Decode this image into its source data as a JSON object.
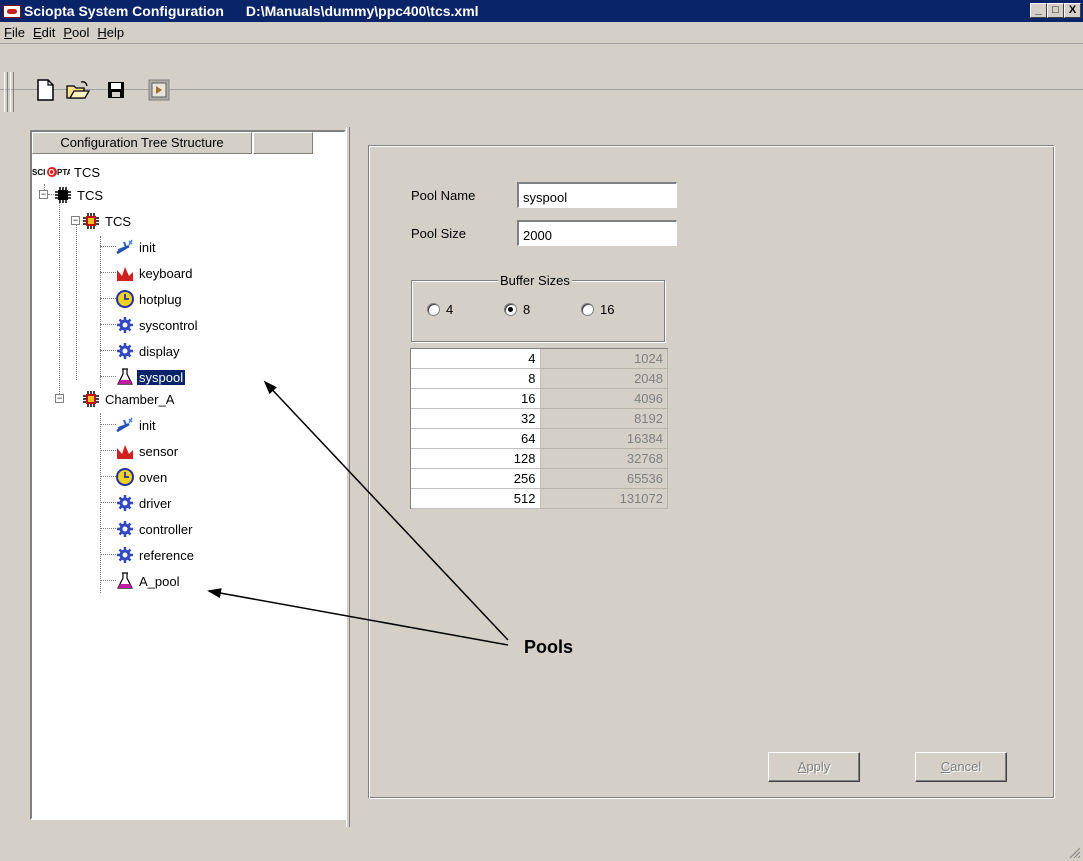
{
  "window": {
    "title": "Sciopta System Configuration",
    "path": "D:\\Manuals\\dummy\\ppc400\\tcs.xml",
    "controls": [
      "_",
      "□",
      "X"
    ]
  },
  "menu": [
    {
      "label": "File",
      "accel": "F",
      "rest": "ile"
    },
    {
      "label": "Edit",
      "accel": "E",
      "rest": "dit"
    },
    {
      "label": "Pool",
      "accel": "P",
      "rest": "ool"
    },
    {
      "label": "Help",
      "accel": "H",
      "rest": "elp"
    }
  ],
  "toolbar": {
    "buttons": [
      "new-document-icon",
      "open-folder-icon",
      "save-disk-icon",
      "exit-door-icon"
    ]
  },
  "tree": {
    "header": "Configuration Tree Structure",
    "root_label": "TCS",
    "root_logo_text": "SCIOPTA",
    "items": [
      {
        "label": "TCS",
        "icon": "cpu-chip-icon"
      },
      {
        "label": "TCS",
        "icon": "module-chip-icon"
      },
      {
        "label": "init",
        "icon": "init-wand-icon"
      },
      {
        "label": "keyboard",
        "icon": "interrupt-process-icon"
      },
      {
        "label": "hotplug",
        "icon": "timer-process-icon"
      },
      {
        "label": "syscontrol",
        "icon": "prioritized-process-icon"
      },
      {
        "label": "display",
        "icon": "prioritized-process-icon"
      },
      {
        "label": "syspool",
        "icon": "pool-flask-icon",
        "selected": true
      },
      {
        "label": "Chamber_A",
        "icon": "module-chip-icon"
      },
      {
        "label": "init",
        "icon": "init-wand-icon"
      },
      {
        "label": "sensor",
        "icon": "interrupt-process-icon"
      },
      {
        "label": "oven",
        "icon": "timer-process-icon"
      },
      {
        "label": "driver",
        "icon": "prioritized-process-icon"
      },
      {
        "label": "controller",
        "icon": "prioritized-process-icon"
      },
      {
        "label": "reference",
        "icon": "prioritized-process-icon"
      },
      {
        "label": "A_pool",
        "icon": "pool-flask-icon"
      }
    ]
  },
  "form": {
    "pool_name_label": "Pool Name",
    "pool_name_value": "syspool",
    "pool_size_label": "Pool Size",
    "pool_size_value": "2000",
    "buffer_sizes_title": "Buffer Sizes",
    "radio_options": [
      {
        "label": "4",
        "checked": false
      },
      {
        "label": "8",
        "checked": true
      },
      {
        "label": "16",
        "checked": false
      }
    ],
    "buffers": [
      [
        "4",
        "1024"
      ],
      [
        "8",
        "2048"
      ],
      [
        "16",
        "4096"
      ],
      [
        "32",
        "8192"
      ],
      [
        "64",
        "16384"
      ],
      [
        "128",
        "32768"
      ],
      [
        "256",
        "65536"
      ],
      [
        "512",
        "131072"
      ]
    ],
    "apply_label": "Apply",
    "apply_accel": "A",
    "apply_rest": "pply",
    "cancel_label": "Cancel",
    "cancel_accel": "C",
    "cancel_rest": "ancel"
  },
  "annotation": {
    "label": "Pools"
  }
}
